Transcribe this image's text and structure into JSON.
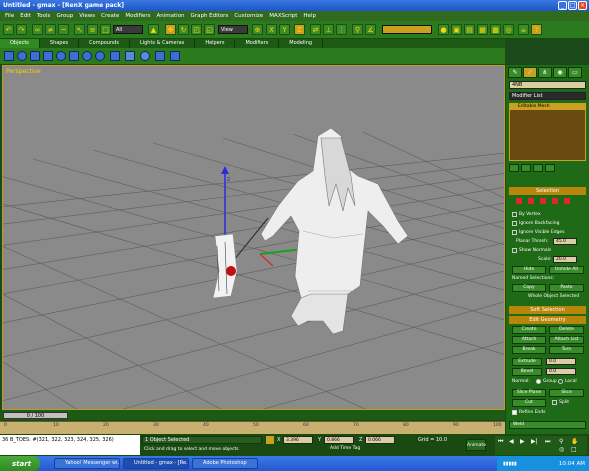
{
  "window": {
    "title": "Untitled - gmax - [RenX game pack]"
  },
  "menu": [
    "File",
    "Edit",
    "Tools",
    "Group",
    "Views",
    "Create",
    "Modifiers",
    "Animation",
    "Graph Editors",
    "Customize",
    "MAXScript",
    "Help"
  ],
  "toolbar": {
    "selection_filter": "All",
    "ref_coord": "View"
  },
  "tabs": [
    "Objects",
    "Shapes",
    "Compounds",
    "Lights & Cameras",
    "Helpers",
    "Modifiers",
    "Modeling"
  ],
  "viewport": {
    "label": "Perspective"
  },
  "command_panel": {
    "object_name": "4NB",
    "modifier_list": "Modifier List",
    "stack_item": "Editable Mesh",
    "selection": {
      "header": "Selection",
      "by_vertex": "By Vertex",
      "ignore_backfacing": "Ignore Backfacing",
      "ignore_visible_edges": "Ignore Visible Edges",
      "planar_thresh": "Planar Thresh:",
      "planar_value": "45.0",
      "show_normals": "Show Normals",
      "scale": "Scale:",
      "scale_value": "20.0",
      "hide": "Hide",
      "unhide_all": "Unhide All",
      "named_selections": "Named Selections:",
      "copy": "Copy",
      "paste": "Paste",
      "whole_object": "Whole Object Selected"
    },
    "soft_selection": "Soft Selection",
    "edit_geometry": {
      "header": "Edit Geometry",
      "create": "Create",
      "delete": "Delete",
      "attach": "Attach",
      "attach_list": "Attach List",
      "break": "Break",
      "turn": "Turn",
      "extrude": "Extrude",
      "extrude_value": "0.0",
      "bevel": "Bevel",
      "bevel_value": "0.0",
      "normal": "Normal:",
      "group": "Group",
      "local": "Local",
      "slice_plane": "Slice Plane",
      "slice": "Slice",
      "cut": "Cut",
      "split": "Split",
      "refine_ends": "Refine Ends",
      "weld": "Weld"
    }
  },
  "timeline": {
    "slider": "0 / 100"
  },
  "ruler_ticks": [
    "0",
    "10",
    "20",
    "30",
    "40",
    "50",
    "60",
    "70",
    "80",
    "90",
    "100"
  ],
  "status": {
    "script_line": "36 B_TOES: #(321, 322, 323, 324, 325, 326)",
    "objects_selected": "1 Object Selected",
    "prompt": "Click and drag to select and move objects",
    "x": "3.396",
    "y": "0.866",
    "z": "0.066",
    "grid": "Grid = 10.0",
    "add_time_tag": "Add Time Tag",
    "animate": "Animate"
  },
  "taskbar": {
    "start": "start",
    "tasks": [
      "Yahoo! Messenger wi...",
      "Untitled - gmax - [Re...",
      "Adobe Photoshop"
    ],
    "time": "10:04 AM"
  }
}
